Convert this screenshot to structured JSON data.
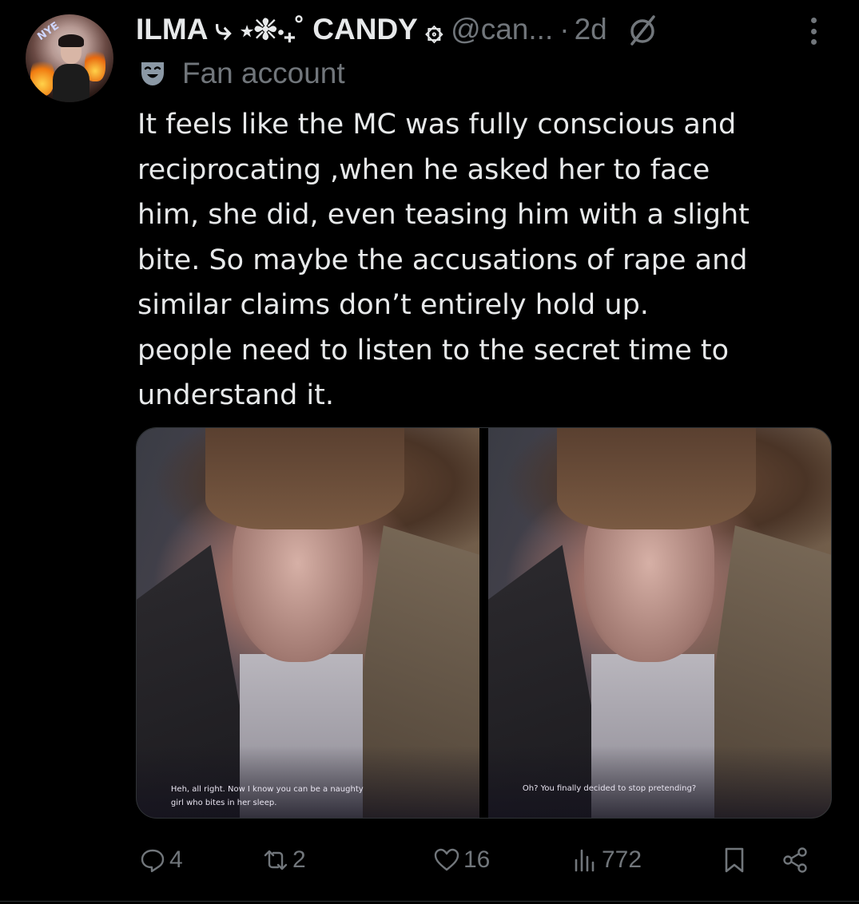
{
  "post": {
    "author_name": "ILMA ⤷ ⋆❈⋅₊˚ CANDY ۞",
    "handle": "@can...",
    "separator": "·",
    "time": "2d",
    "label": "Fan account",
    "text_lines": [
      "It feels like the MC was fully conscious and",
      "reciprocating ,when he asked her to face",
      "him, she did, even teasing him with a slight",
      "bite. So maybe the accusations of rape and",
      "similar claims don’t entirely hold up.",
      "people need to listen to the secret time to",
      "understand it."
    ],
    "avatar_sign": "NYE"
  },
  "media": {
    "left_caption_line1": "Heh, all right. Now I know you can be a naughty",
    "left_caption_line2": "girl who bites in her sleep.",
    "right_caption": "Oh? You finally decided to stop pretending?"
  },
  "actions": {
    "replies": "4",
    "reposts": "2",
    "likes": "16",
    "views": "772"
  },
  "icons": {
    "muted_color": "#71767b",
    "text_color": "#e7e9ea"
  }
}
